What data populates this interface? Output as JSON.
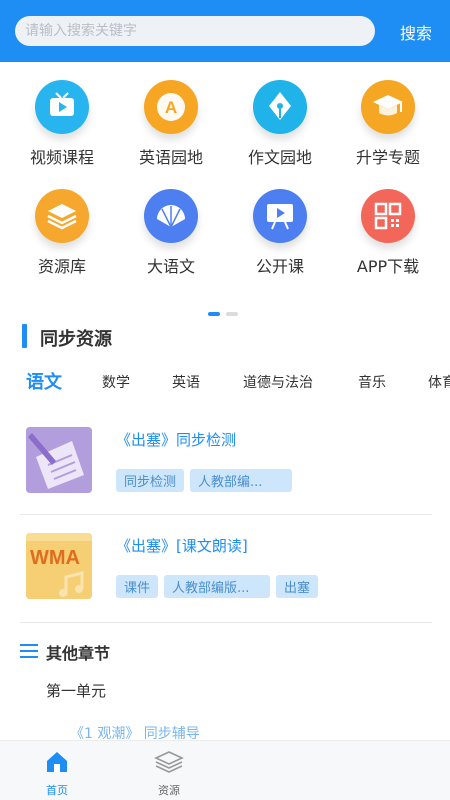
{
  "search": {
    "placeholder": "请输入搜索关键字",
    "button_label": "搜索"
  },
  "grid": [
    {
      "label": "视频课程",
      "icon": "tv-icon",
      "color": "#28b4ef"
    },
    {
      "label": "英语园地",
      "icon": "letter-a-icon",
      "color": "#f6a623"
    },
    {
      "label": "作文园地",
      "icon": "pen-nib-icon",
      "color": "#1fb3ea"
    },
    {
      "label": "升学专题",
      "icon": "graduation-cap-icon",
      "color": "#f5a623"
    },
    {
      "label": "资源库",
      "icon": "layers-icon",
      "color": "#f6a82e"
    },
    {
      "label": "大语文",
      "icon": "fan-icon",
      "color": "#4d7ff0"
    },
    {
      "label": "公开课",
      "icon": "presentation-icon",
      "color": "#4d7ff0"
    },
    {
      "label": "APP下载",
      "icon": "qr-code-icon",
      "color": "#f2675a"
    }
  ],
  "section": {
    "title": "同步资源"
  },
  "tabs": [
    "语文",
    "数学",
    "英语",
    "道德与法治",
    "音乐",
    "体育"
  ],
  "active_tab": "语文",
  "resources": [
    {
      "title": "《出塞》同步检测",
      "tags": [
        "同步检测",
        "人教部编..."
      ],
      "thumb": "document-pen-icon"
    },
    {
      "title": "《出塞》[课文朗读]",
      "tags": [
        "课件",
        "人教部编版...",
        "出塞"
      ],
      "thumb": "wma-audio-icon",
      "thumb_text": "WMA"
    }
  ],
  "other": {
    "title": "其他章节",
    "unit": "第一单元",
    "chapter": "《1 观潮》 同步辅导"
  },
  "bottom_nav": [
    {
      "label": "首页",
      "icon": "home-icon",
      "active": true
    },
    {
      "label": "资源",
      "icon": "layers-icon",
      "active": false
    }
  ],
  "colors": {
    "primary": "#1e8ef5",
    "tag_bg": "#cde6fb",
    "tag_text": "#4a8fd0"
  }
}
